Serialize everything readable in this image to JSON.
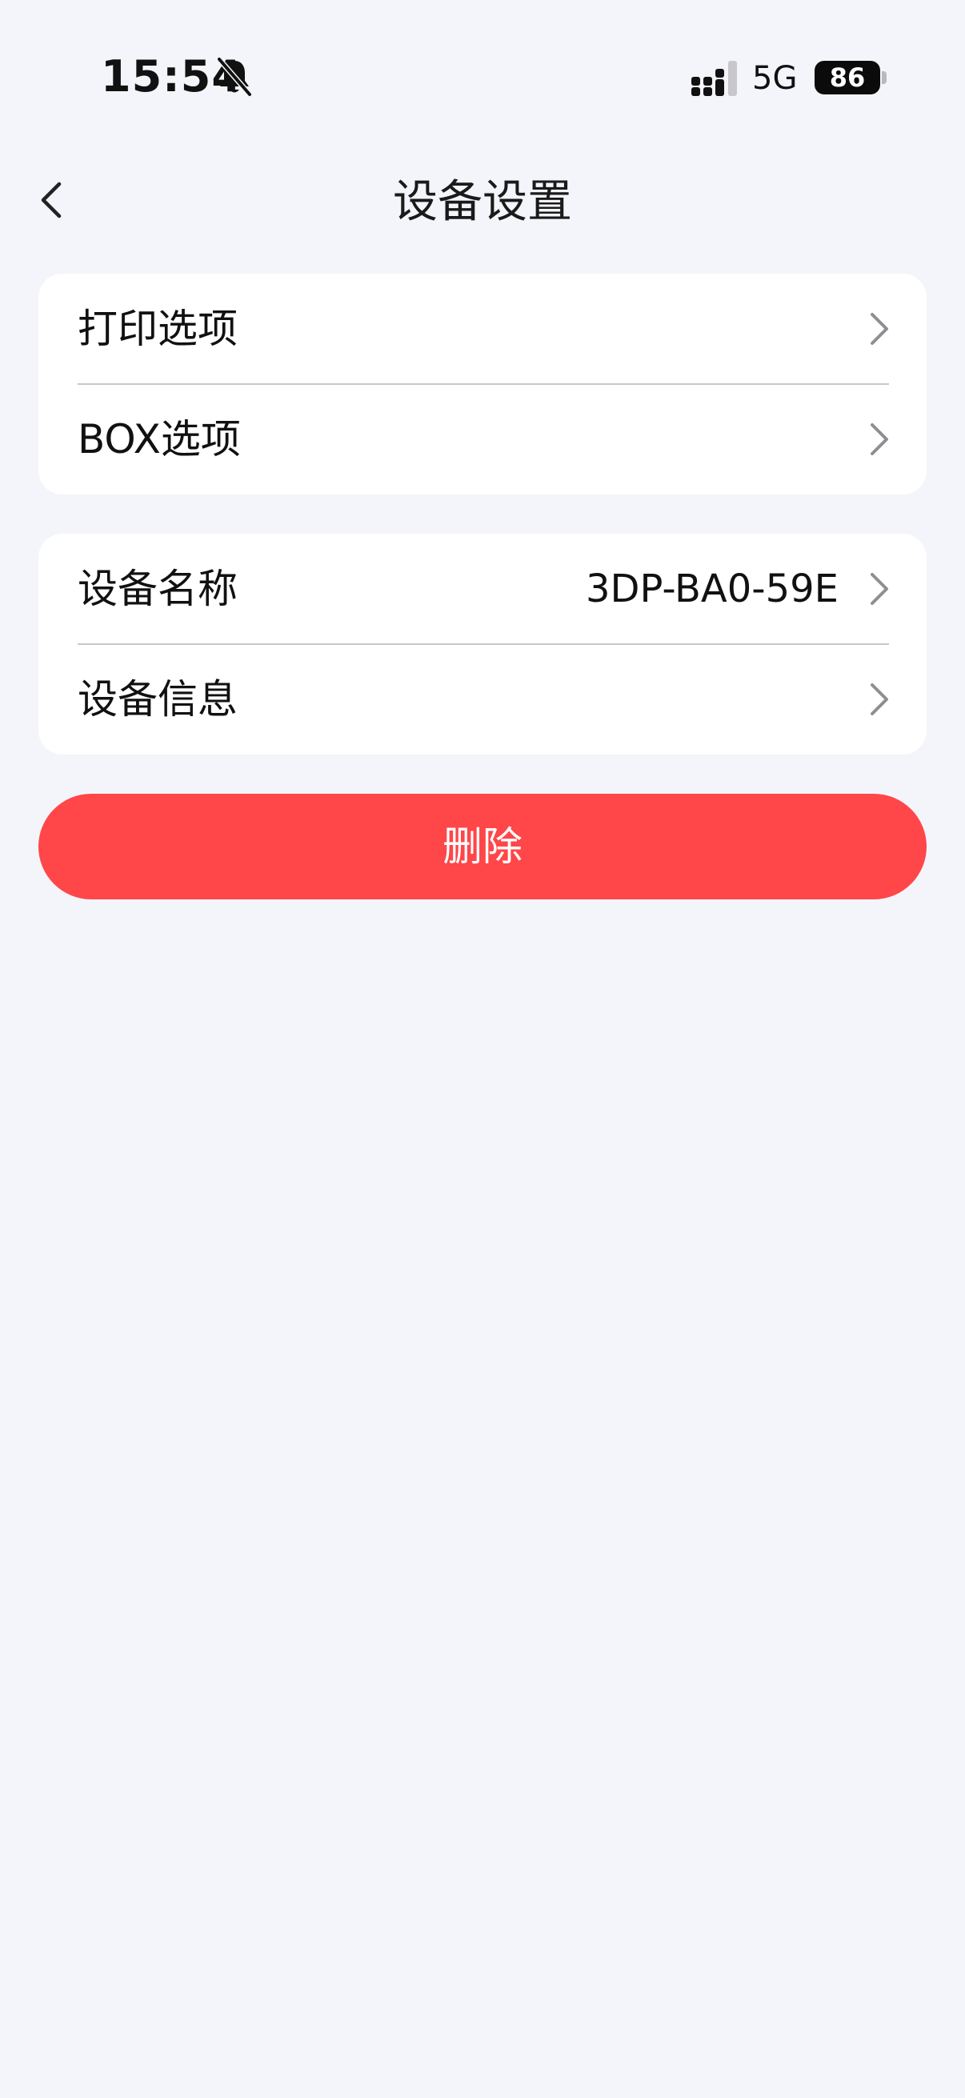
{
  "status_bar": {
    "time": "15:54",
    "network": "5G",
    "battery": "86"
  },
  "header": {
    "title": "设备设置"
  },
  "groups": [
    {
      "items": [
        {
          "label": "打印选项"
        },
        {
          "label": "BOX选项"
        }
      ]
    },
    {
      "items": [
        {
          "label": "设备名称",
          "value": "3DP-BA0-59E"
        },
        {
          "label": "设备信息"
        }
      ]
    }
  ],
  "actions": {
    "delete_label": "删除"
  },
  "colors": {
    "background": "#f4f5fa",
    "card": "#ffffff",
    "danger": "#ff4649",
    "chevron": "#8e8e93"
  }
}
